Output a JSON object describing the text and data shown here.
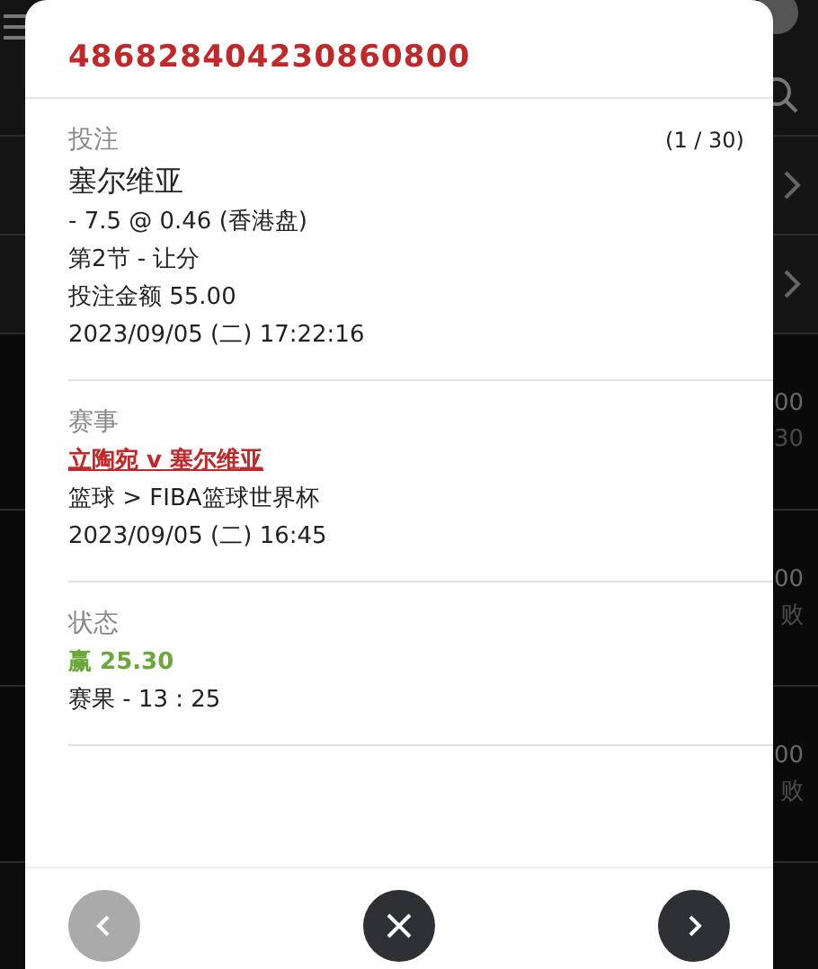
{
  "background": {
    "rows": [
      {
        "kind": "chevron"
      },
      {
        "kind": "chevron"
      },
      {
        "kind": "amounts",
        "texts": [
          "00",
          "30"
        ]
      },
      {
        "kind": "amounts",
        "texts": [
          "00",
          "败"
        ]
      },
      {
        "kind": "amounts",
        "texts": [
          "00",
          "败"
        ]
      }
    ]
  },
  "modal": {
    "bet_id": "486828404230860800",
    "sections": [
      {
        "label": "投注",
        "counter": "(1 / 30)",
        "lines": [
          {
            "kind": "title",
            "text": "塞尔维亚"
          },
          {
            "kind": "text",
            "text": "- 7.5 @ 0.46 (香港盘)"
          },
          {
            "kind": "text",
            "text": "第2节 - 让分"
          },
          {
            "kind": "text",
            "text": "投注金额 55.00"
          },
          {
            "kind": "text",
            "text": "2023/09/05 (二) 17:22:16"
          }
        ]
      },
      {
        "label": "赛事",
        "lines": [
          {
            "kind": "link",
            "text": "立陶宛 v 塞尔维亚"
          },
          {
            "kind": "text",
            "text": "篮球 > FIBA篮球世界杯"
          },
          {
            "kind": "text",
            "text": "2023/09/05 (二) 16:45"
          }
        ]
      },
      {
        "label": "状态",
        "lines": [
          {
            "kind": "win",
            "text": "赢 25.30"
          },
          {
            "kind": "text",
            "text": "赛果 - 13 : 25"
          }
        ]
      }
    ]
  },
  "footer": {
    "buttons": [
      {
        "kind": "prev",
        "disabled": true
      },
      {
        "kind": "close",
        "disabled": false
      },
      {
        "kind": "next",
        "disabled": false
      }
    ]
  }
}
